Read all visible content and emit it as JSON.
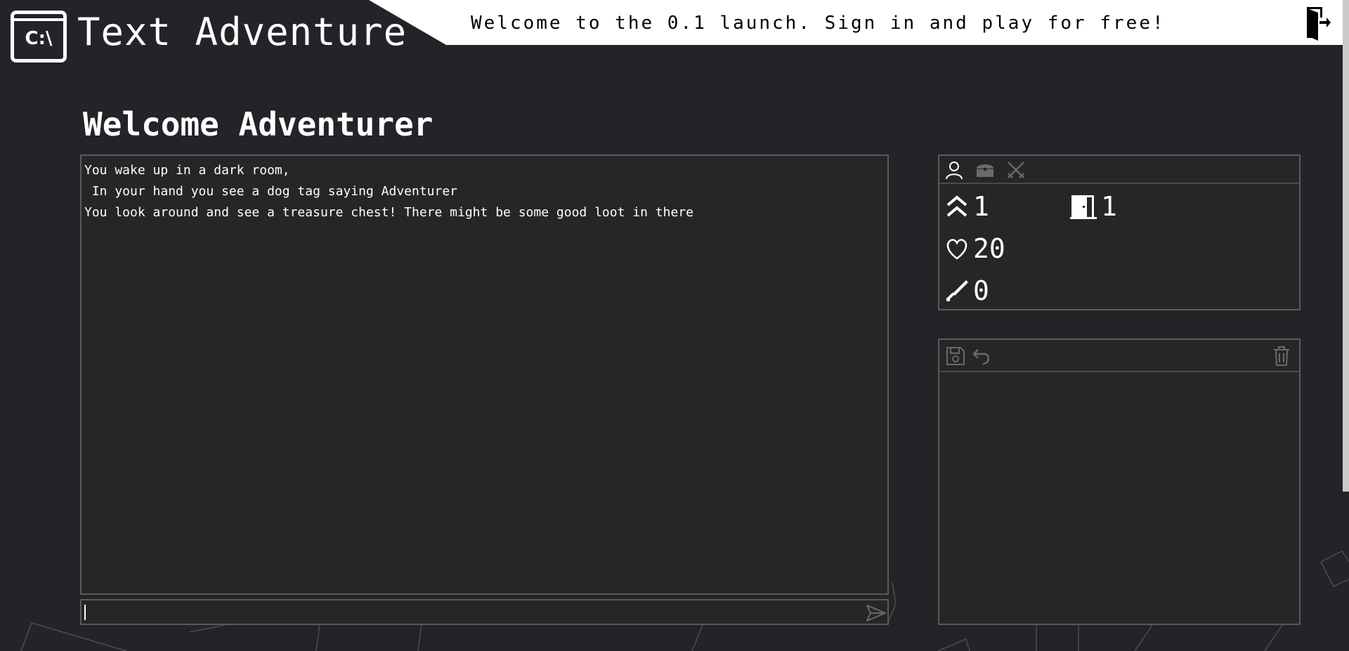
{
  "header": {
    "logo_text": "C:\\",
    "app_title": "Text Adventure",
    "banner": "Welcome to the 0.1 launch. Sign in and play for free!",
    "signin_icon": "sign-in-door-icon"
  },
  "main": {
    "title": "Welcome Adventurer",
    "log_lines": [
      "You wake up in a dark room,",
      " In your hand you see a dog tag saying Adventurer",
      "You look around and see a treasure chest! There might be some good loot in there"
    ],
    "command_input": {
      "value": "",
      "placeholder": ""
    },
    "send_icon": "send-arrow-icon"
  },
  "stats_panel": {
    "tabs": [
      {
        "name": "character",
        "icon": "person-icon",
        "active": true
      },
      {
        "name": "inventory",
        "icon": "chest-icon",
        "active": false
      },
      {
        "name": "combat",
        "icon": "crossed-swords-icon",
        "active": false
      }
    ],
    "level": "1",
    "room": "1",
    "health": "20",
    "attack": "0"
  },
  "inventory_panel": {
    "tools": [
      {
        "name": "save",
        "icon": "save-icon"
      },
      {
        "name": "undo",
        "icon": "undo-icon"
      },
      {
        "name": "delete",
        "icon": "trash-icon"
      }
    ]
  },
  "colors": {
    "background": "#222428",
    "panel": "#262626",
    "border": "#5a5a5a",
    "text": "#ffffff",
    "banner_bg": "#ffffff",
    "muted_icon": "#6a6a6a"
  }
}
